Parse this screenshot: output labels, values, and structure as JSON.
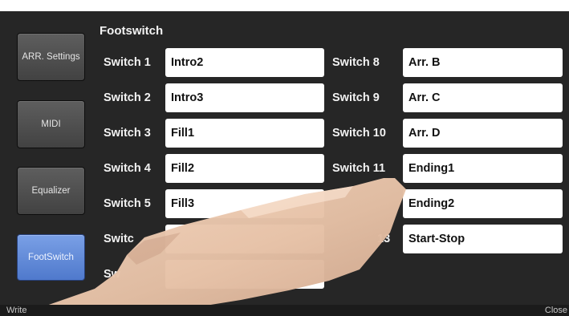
{
  "title": "Footswitch",
  "sidebar": {
    "items": [
      {
        "label": "ARR. Settings"
      },
      {
        "label": "MIDI"
      },
      {
        "label": "Equalizer"
      },
      {
        "label": "FootSwitch",
        "active": true
      }
    ]
  },
  "switches_left": [
    {
      "label": "Switch 1",
      "value": "Intro2"
    },
    {
      "label": "Switch 2",
      "value": "Intro3"
    },
    {
      "label": "Switch 3",
      "value": "Fill1"
    },
    {
      "label": "Switch 4",
      "value": "Fill2"
    },
    {
      "label": "Switch 5",
      "value": "Fill3"
    },
    {
      "label": "Switc",
      "value": ""
    },
    {
      "label": "Sw",
      "value": ""
    }
  ],
  "switches_right": [
    {
      "label": "Switch 8",
      "value": "Arr. B"
    },
    {
      "label": "Switch 9",
      "value": "Arr. C"
    },
    {
      "label": "Switch 10",
      "value": "Arr. D"
    },
    {
      "label": "Switch 11",
      "value": "Ending1"
    },
    {
      "label": "",
      "value": "Ending2"
    },
    {
      "label": "13",
      "value": "Start-Stop"
    }
  ],
  "bottom": {
    "write_label": "Write",
    "close_label": "Close"
  },
  "colors": {
    "background": "#262626",
    "active_button": "#5b84d6",
    "field": "#ffffff"
  },
  "overlay": "hand-photo"
}
